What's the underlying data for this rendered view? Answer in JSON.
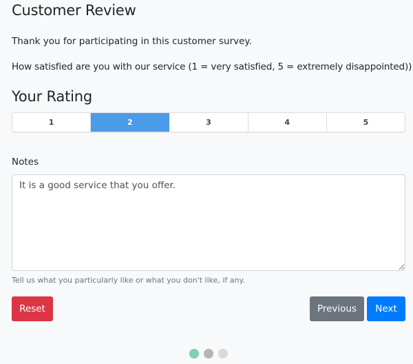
{
  "header": {
    "title": "Customer Review",
    "intro": "Thank you for participating in this customer survey.",
    "question": "How satisfied are you with our service (1 = very satisfied, 5 = extremely disappointed))"
  },
  "rating": {
    "title": "Your Rating",
    "options": [
      "1",
      "2",
      "3",
      "4",
      "5"
    ],
    "selected": "2",
    "active_color": "#4a9ce8"
  },
  "notes": {
    "label": "Notes",
    "value": "It is a good service that you offer.",
    "help": "Tell us what you particularly like or what you don't like, if any."
  },
  "buttons": {
    "reset": "Reset",
    "previous": "Previous",
    "next": "Next"
  },
  "pager": {
    "current_step": 1,
    "total_steps": 3,
    "dots": [
      {
        "state": "active",
        "color": "#7fcfb0"
      },
      {
        "state": "completed",
        "color": "#b5b5b5"
      },
      {
        "state": "pending",
        "color": "#d9d9d9"
      }
    ]
  }
}
